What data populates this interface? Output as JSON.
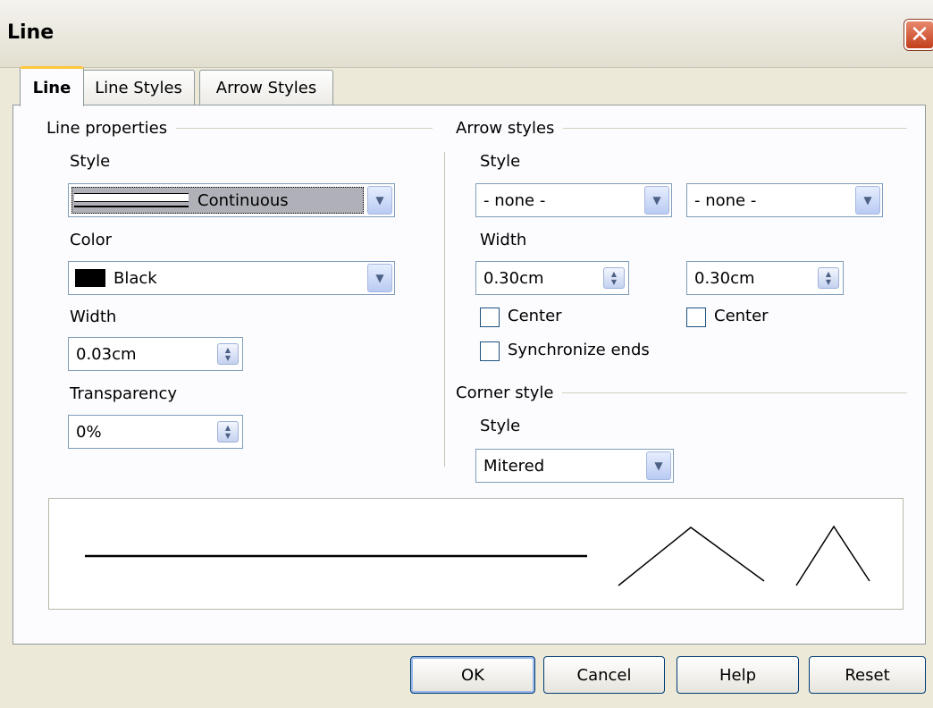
{
  "window": {
    "title": "Line",
    "close_symbol": "✕"
  },
  "tabs": [
    {
      "label": "Line",
      "active": true
    },
    {
      "label": "Line Styles",
      "active": false
    },
    {
      "label": "Arrow Styles",
      "active": false
    }
  ],
  "line_properties": {
    "heading": "Line properties",
    "style_label": "Style",
    "style_value": "Continuous",
    "color_label": "Color",
    "color_value": "Black",
    "color_swatch": "#000000",
    "width_label": "Width",
    "width_value": "0.03cm",
    "transparency_label": "Transparency",
    "transparency_value": "0%"
  },
  "arrow_styles": {
    "heading": "Arrow styles",
    "style_label": "Style",
    "start_style": "- none -",
    "end_style": "- none -",
    "width_label": "Width",
    "start_width": "0.30cm",
    "end_width": "0.30cm",
    "center_label": "Center",
    "synchronize_label": "Synchronize ends"
  },
  "corner_style": {
    "heading": "Corner style",
    "style_label": "Style",
    "style_value": "Mitered"
  },
  "buttons": {
    "ok": "OK",
    "cancel": "Cancel",
    "help": "Help",
    "reset": "Reset"
  }
}
